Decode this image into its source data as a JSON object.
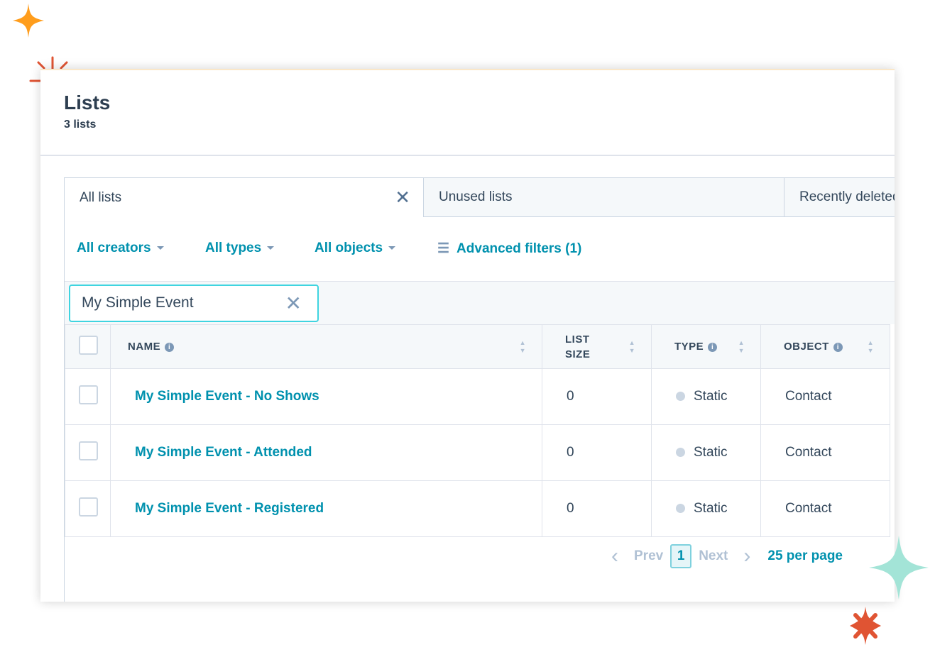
{
  "header": {
    "title": "Lists",
    "count": "3 lists"
  },
  "tabs": [
    {
      "label": "All lists",
      "active": true
    },
    {
      "label": "Unused lists"
    },
    {
      "label": "Recently deleted"
    }
  ],
  "filters": {
    "creators": "All creators",
    "types": "All types",
    "objects": "All objects",
    "advanced": "Advanced filters (1)"
  },
  "search": {
    "value": "My Simple Event"
  },
  "table": {
    "headers": {
      "name": "NAME",
      "list_size_1": "LIST",
      "list_size_2": "SIZE",
      "type": "TYPE",
      "object": "OBJECT"
    },
    "rows": [
      {
        "name": "My Simple Event - No Shows",
        "size": "0",
        "type": "Static",
        "object": "Contact"
      },
      {
        "name": "My Simple Event - Attended",
        "size": "0",
        "type": "Static",
        "object": "Contact"
      },
      {
        "name": "My Simple Event - Registered",
        "size": "0",
        "type": "Static",
        "object": "Contact"
      }
    ]
  },
  "pagination": {
    "prev": "Prev",
    "page": "1",
    "next": "Next",
    "per_page": "25 per page"
  },
  "colors": {
    "accent": "#0091ae",
    "text": "#33475b",
    "orange": "#ff9d1c",
    "red": "#e05433",
    "mint": "#a3e4d7"
  }
}
